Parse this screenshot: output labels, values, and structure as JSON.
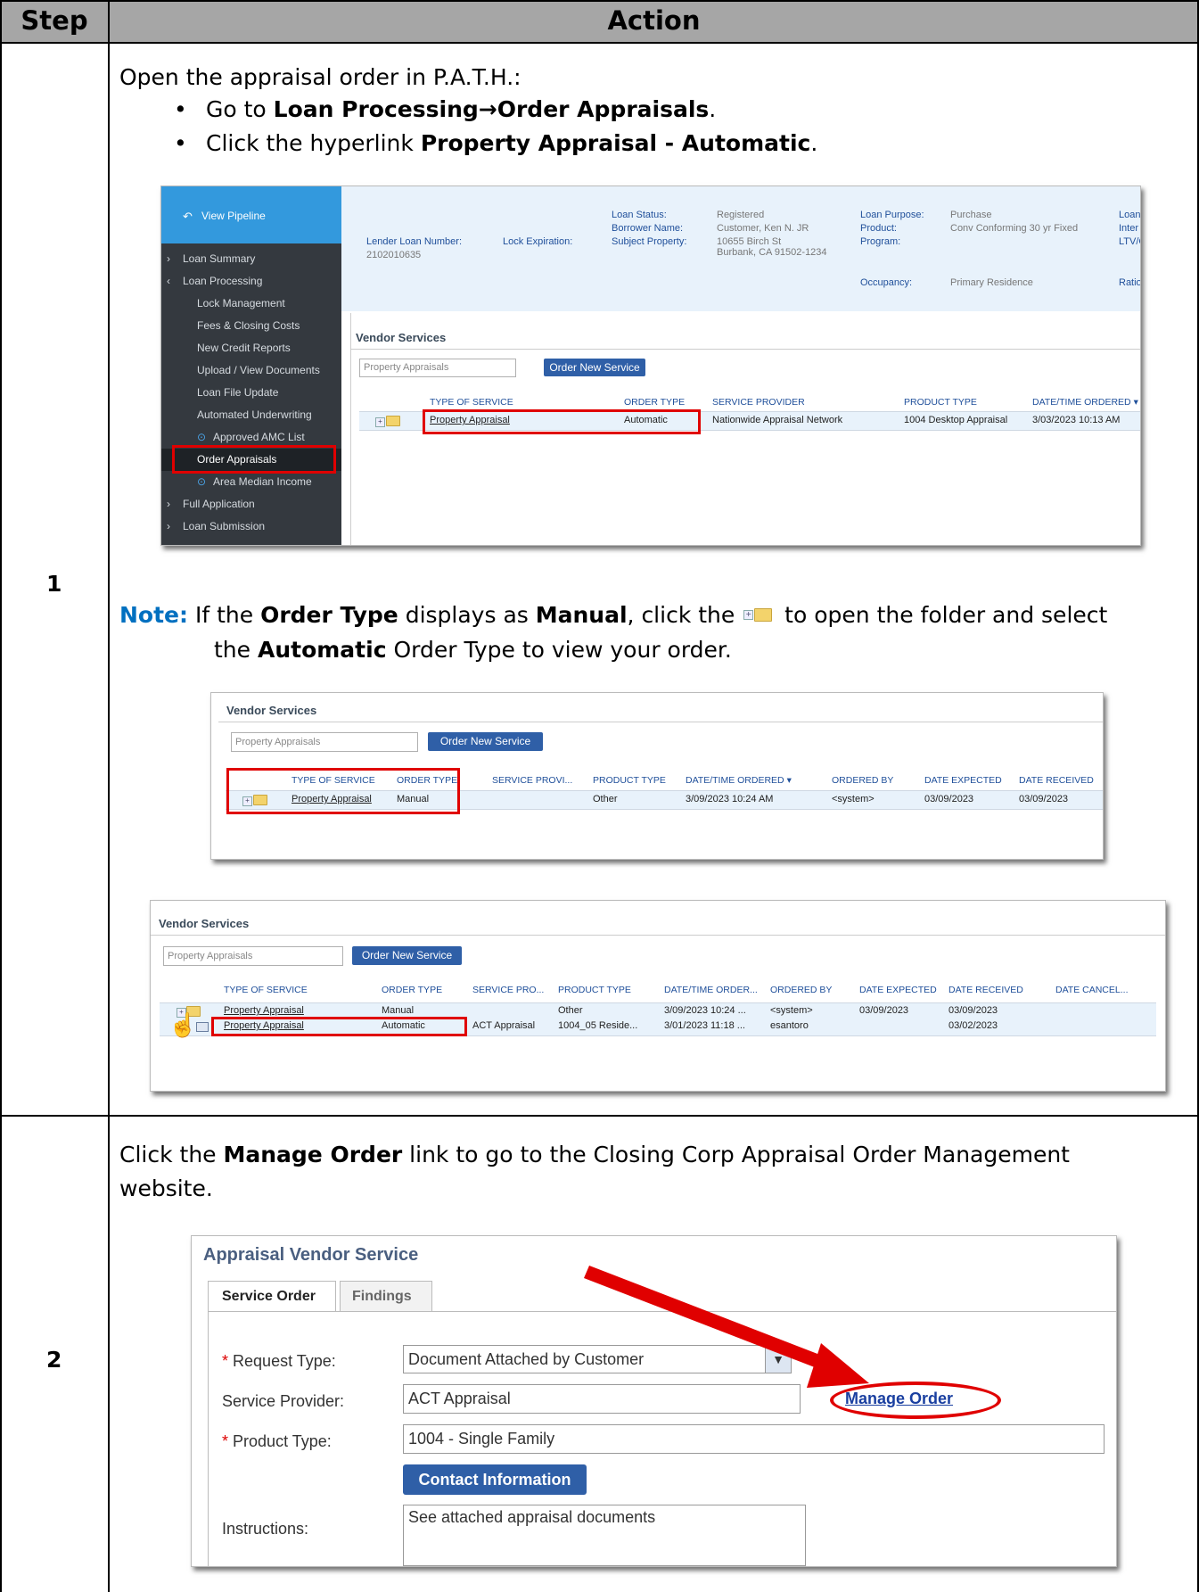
{
  "table": {
    "header_step": "Step",
    "header_action": "Action"
  },
  "step1": {
    "number": "1",
    "intro": "Open the appraisal order in P.A.T.H.:",
    "bullet1_prefix": "Go to ",
    "bullet1_bold": "Loan Processing→Order Appraisals",
    "bullet1_suffix": ".",
    "bullet2_prefix": "Click the hyperlink ",
    "bullet2_bold": "Property Appraisal - Automatic",
    "bullet2_suffix": ".",
    "note_label": "Note:",
    "note_t1": " If the ",
    "note_b1": "Order Type",
    "note_t2": " displays as ",
    "note_b2": "Manual",
    "note_t3": ", click the ",
    "note_t4": " to open the folder and select",
    "note_line2_t1": "the ",
    "note_line2_b1": "Automatic",
    "note_line2_t2": " Order Type to view your order."
  },
  "shot1": {
    "view_pipeline": "View Pipeline",
    "nav": [
      {
        "label": "Loan Summary",
        "type": "top"
      },
      {
        "label": "Loan Processing",
        "type": "top-open"
      },
      {
        "label": "Lock Management",
        "type": "sub"
      },
      {
        "label": "Fees & Closing Costs",
        "type": "sub"
      },
      {
        "label": "New Credit Reports",
        "type": "sub"
      },
      {
        "label": "Upload / View Documents",
        "type": "sub"
      },
      {
        "label": "Loan File Update",
        "type": "sub"
      },
      {
        "label": "Automated Underwriting",
        "type": "sub"
      },
      {
        "label": "Approved AMC List",
        "type": "subicon"
      },
      {
        "label": "Order Appraisals",
        "type": "active"
      },
      {
        "label": "Area Median Income",
        "type": "subicon"
      },
      {
        "label": "Full Application",
        "type": "top"
      },
      {
        "label": "Loan Submission",
        "type": "top"
      }
    ],
    "lender_loan_number_label": "Lender Loan Number:",
    "lender_loan_number": "2102010635",
    "lock_expiration_label": "Lock Expiration:",
    "loan_status_label": "Loan Status:",
    "loan_status": "Registered",
    "borrower_name_label": "Borrower Name:",
    "borrower_name": "Customer, Ken N. JR",
    "subject_property_label": "Subject Property:",
    "subject_property_1": "10655 Birch St",
    "subject_property_2": "Burbank, CA 91502-1234",
    "loan_purpose_label": "Loan Purpose:",
    "loan_purpose": "Purchase",
    "product_label": "Product:",
    "product": "Conv Conforming 30 yr Fixed",
    "program_label": "Program:",
    "occupancy_label": "Occupancy:",
    "occupancy": "Primary Residence",
    "cut1": "Loan",
    "cut2": "Inter",
    "cut3": "LTV/C",
    "cut4": "Ratio",
    "vendor_services": "Vendor Services",
    "search_placeholder": "Property Appraisals",
    "order_new_service": "Order New Service",
    "col_type": "TYPE OF SERVICE",
    "col_order": "ORDER TYPE",
    "col_provider": "SERVICE PROVIDER",
    "col_product": "PRODUCT TYPE",
    "col_date": "DATE/TIME ORDERED",
    "row_service": "Property Appraisal",
    "row_order": "Automatic",
    "row_provider": "Nationwide Appraisal Network",
    "row_product": "1004 Desktop Appraisal",
    "row_date": "3/03/2023 10:13 AM"
  },
  "shot2": {
    "vendor_services": "Vendor Services",
    "search_placeholder": "Property Appraisals",
    "order_new_service": "Order New Service",
    "col_type": "TYPE OF SERVICE",
    "col_order": "ORDER TYPE",
    "col_provider": "SERVICE PROVI...",
    "col_product": "PRODUCT TYPE",
    "col_date": "DATE/TIME ORDERED",
    "col_by": "ORDERED BY",
    "col_expected": "DATE EXPECTED",
    "col_received": "DATE RECEIVED",
    "row_service": "Property Appraisal",
    "row_order": "Manual",
    "row_product": "Other",
    "row_date": "3/09/2023 10:24 AM",
    "row_by": "<system>",
    "row_expected": "03/09/2023",
    "row_received": "03/09/2023"
  },
  "shot3": {
    "vendor_services": "Vendor Services",
    "search_placeholder": "Property Appraisals",
    "order_new_service": "Order New Service",
    "col_type": "TYPE OF SERVICE",
    "col_order": "ORDER TYPE",
    "col_provider": "SERVICE PRO...",
    "col_product": "PRODUCT TYPE",
    "col_date": "DATE/TIME ORDER...",
    "col_by": "ORDERED BY",
    "col_expected": "DATE EXPECTED",
    "col_received": "DATE RECEIVED",
    "col_cancel": "DATE CANCEL...",
    "rows": [
      {
        "service": "Property Appraisal",
        "order": "Manual",
        "provider": "",
        "product": "Other",
        "date": "3/09/2023 10:24 ...",
        "by": "<system>",
        "expected": "03/09/2023",
        "received": "03/09/2023"
      },
      {
        "service": "Property Appraisal",
        "order": "Automatic",
        "provider": "ACT Appraisal",
        "product": "1004_05 Reside...",
        "date": "3/01/2023 11:18 ...",
        "by": "esantoro",
        "expected": "",
        "received": "03/02/2023"
      }
    ]
  },
  "step2": {
    "number": "2",
    "t1": "Click the ",
    "b1": "Manage Order",
    "t2": " link to go to the Closing Corp Appraisal Order Management",
    "line2": "website."
  },
  "shot4": {
    "title": "Appraisal Vendor Service",
    "tab1": "Service Order",
    "tab2": "Findings",
    "request_type_label": "Request Type:",
    "request_type": "Document Attached by Customer",
    "service_provider_label": "Service Provider:",
    "service_provider": "ACT Appraisal",
    "manage_order": "Manage Order",
    "product_type_label": "Product Type:",
    "product_type": "1004 - Single Family",
    "contact_information": "Contact Information",
    "instructions_label": "Instructions:",
    "instructions": "See attached appraisal documents",
    "required_mark": "*"
  },
  "colors": {
    "header_gray": "#a6a6a6",
    "note_blue": "#0070c0",
    "highlight_red": "#e00000",
    "nav_blue": "#3399dd",
    "nav_dark": "#34393f"
  }
}
